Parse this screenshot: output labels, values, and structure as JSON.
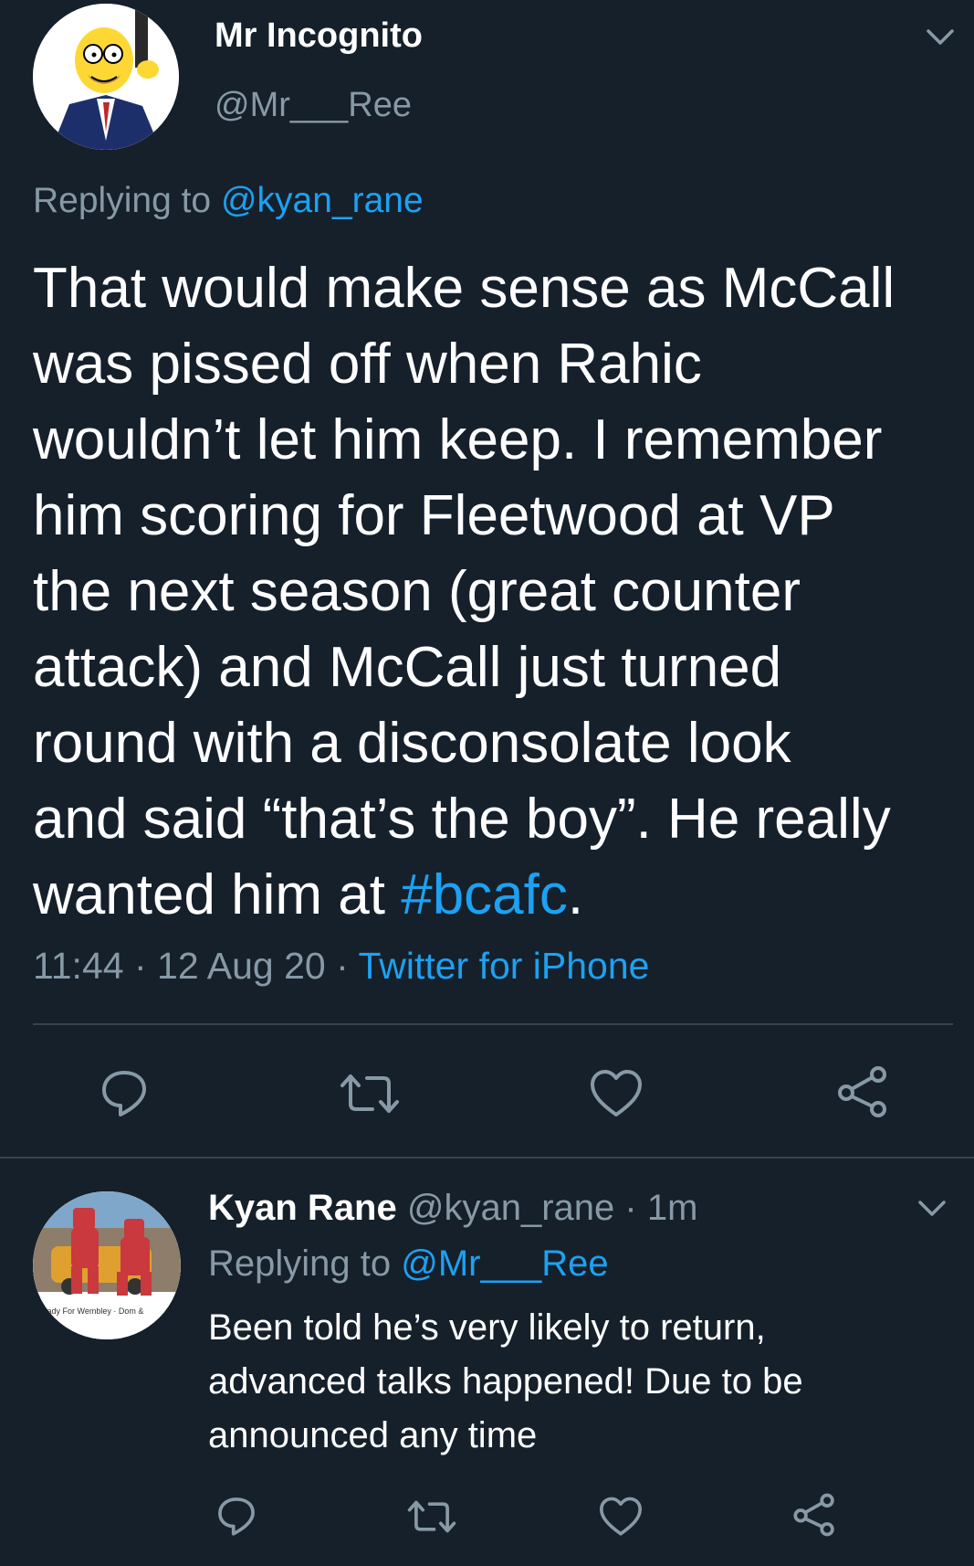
{
  "main_tweet": {
    "display_name": "Mr Incognito",
    "handle": "@Mr___Ree",
    "replying_prefix": "Replying to",
    "replying_handle": "@kyan_rane",
    "text_lines": [
      "That would make sense as McCall",
      "was pissed off when Rahic",
      "wouldn’t let him keep. I remember",
      "him scoring for Fleetwood at VP",
      "the next season (great counter",
      "attack) and McCall just turned",
      "round with a disconsolate look",
      "and said “that’s the boy”. He really"
    ],
    "last_line_prefix": "wanted him at ",
    "hashtag": "#bcafc",
    "last_line_suffix": ".",
    "time": "11:44",
    "date": "12 Aug 20",
    "separator": "·",
    "source": "Twitter for iPhone",
    "avatar_icon": "cartoon-avatar"
  },
  "reply_tweet": {
    "display_name": "Kyan Rane",
    "handle": "@kyan_rane",
    "separator": "·",
    "age": "1m",
    "replying_prefix": "Replying to",
    "replying_handle": "@Mr___Ree",
    "text_lines": [
      "Been told he’s very likely to return,",
      "advanced talks happened! Due to be",
      "announced any time"
    ],
    "avatar_caption": "Ready For Wembley · Dom &"
  },
  "icons": {
    "reply": "reply-icon",
    "retweet": "retweet-icon",
    "like": "like-icon",
    "share": "share-icon",
    "menu": "chevron-down-icon"
  },
  "colors": {
    "background": "#15202b",
    "text": "#ffffff",
    "muted": "#8899a6",
    "link": "#1da1f2",
    "divider": "#38444d"
  }
}
